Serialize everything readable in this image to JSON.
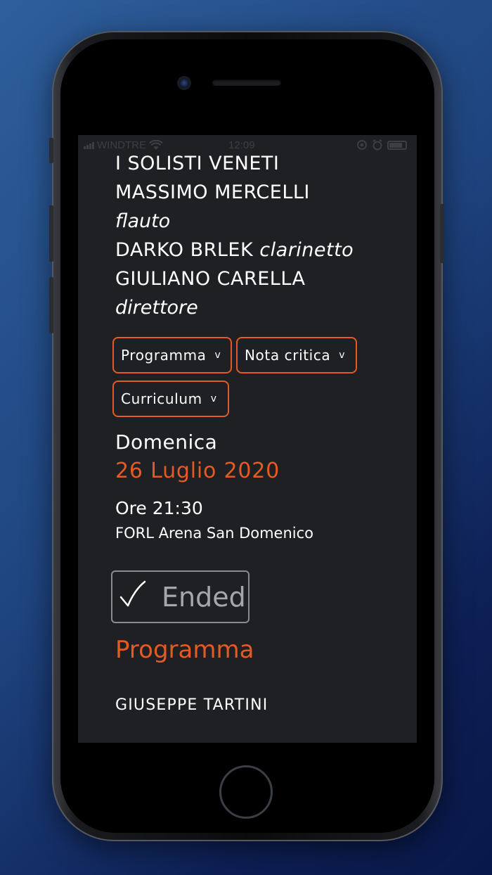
{
  "status_bar": {
    "carrier": "WINDTRE",
    "time": "12:09"
  },
  "performers": [
    {
      "name": "I SOLISTI VENETI",
      "role": ""
    },
    {
      "name": "MASSIMO MERCELLI",
      "role": "flauto"
    },
    {
      "name": "DARKO BRLEK",
      "role": "clarinetto"
    },
    {
      "name": "GIULIANO CARELLA",
      "role": "direttore"
    }
  ],
  "tabs": [
    {
      "label": "Programma",
      "chevron": "v"
    },
    {
      "label": "Nota critica",
      "chevron": "v"
    },
    {
      "label": "Curriculum",
      "chevron": "v"
    }
  ],
  "event": {
    "weekday": "Domenica",
    "date": "26 Luglio 2020",
    "time": "Ore 21:30",
    "venue": "FORL Arena San Domenico",
    "status": "Ended"
  },
  "program": {
    "title": "Programma",
    "composer": "GIUSEPPE TARTINI"
  },
  "colors": {
    "accent": "#e55a22",
    "screen_bg": "#1f2024",
    "text": "#ffffff",
    "muted": "#a6a7ab"
  }
}
